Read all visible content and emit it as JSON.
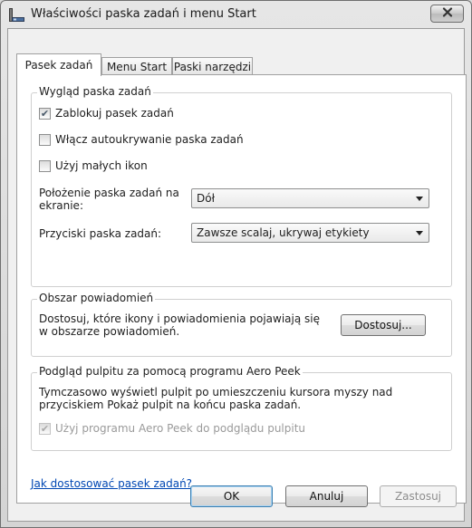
{
  "window": {
    "title": "Właściwości paska zadań i menu Start",
    "icon": "taskbar-properties-icon",
    "close_icon": "close-icon"
  },
  "tabs": [
    {
      "label": "Pasek zadań",
      "active": true
    },
    {
      "label": "Menu Start",
      "active": false
    },
    {
      "label": "Paski narzędzi",
      "active": false
    }
  ],
  "appearance": {
    "title": "Wygląd paska zadań",
    "lock": {
      "label": "Zablokuj pasek zadań",
      "checked": true
    },
    "autohide": {
      "label": "Włącz autoukrywanie paska zadań",
      "checked": false
    },
    "small_icons": {
      "label": "Użyj małych ikon",
      "checked": false
    },
    "location_label": "Położenie paska zadań na ekranie:",
    "location_value": "Dół",
    "buttons_label": "Przyciski paska zadań:",
    "buttons_value": "Zawsze scalaj, ukrywaj etykiety"
  },
  "notification": {
    "title": "Obszar powiadomień",
    "description": "Dostosuj, które ikony i powiadomienia pojawiają się w obszarze powiadomień.",
    "customize_button": "Dostosuj..."
  },
  "peek": {
    "title": "Podgląd pulpitu za pomocą programu Aero Peek",
    "description": "Tymczasowo wyświetl pulpit po umieszczeniu kursora myszy nad przyciskiem Pokaż pulpit na końcu paska zadań.",
    "use_peek": {
      "label": "Użyj programu Aero Peek do podglądu pulpitu",
      "checked": true,
      "enabled": false
    }
  },
  "help_link": "Jak dostosować pasek zadań?",
  "buttons": {
    "ok": "OK",
    "cancel": "Anuluj",
    "apply": "Zastosuj"
  }
}
